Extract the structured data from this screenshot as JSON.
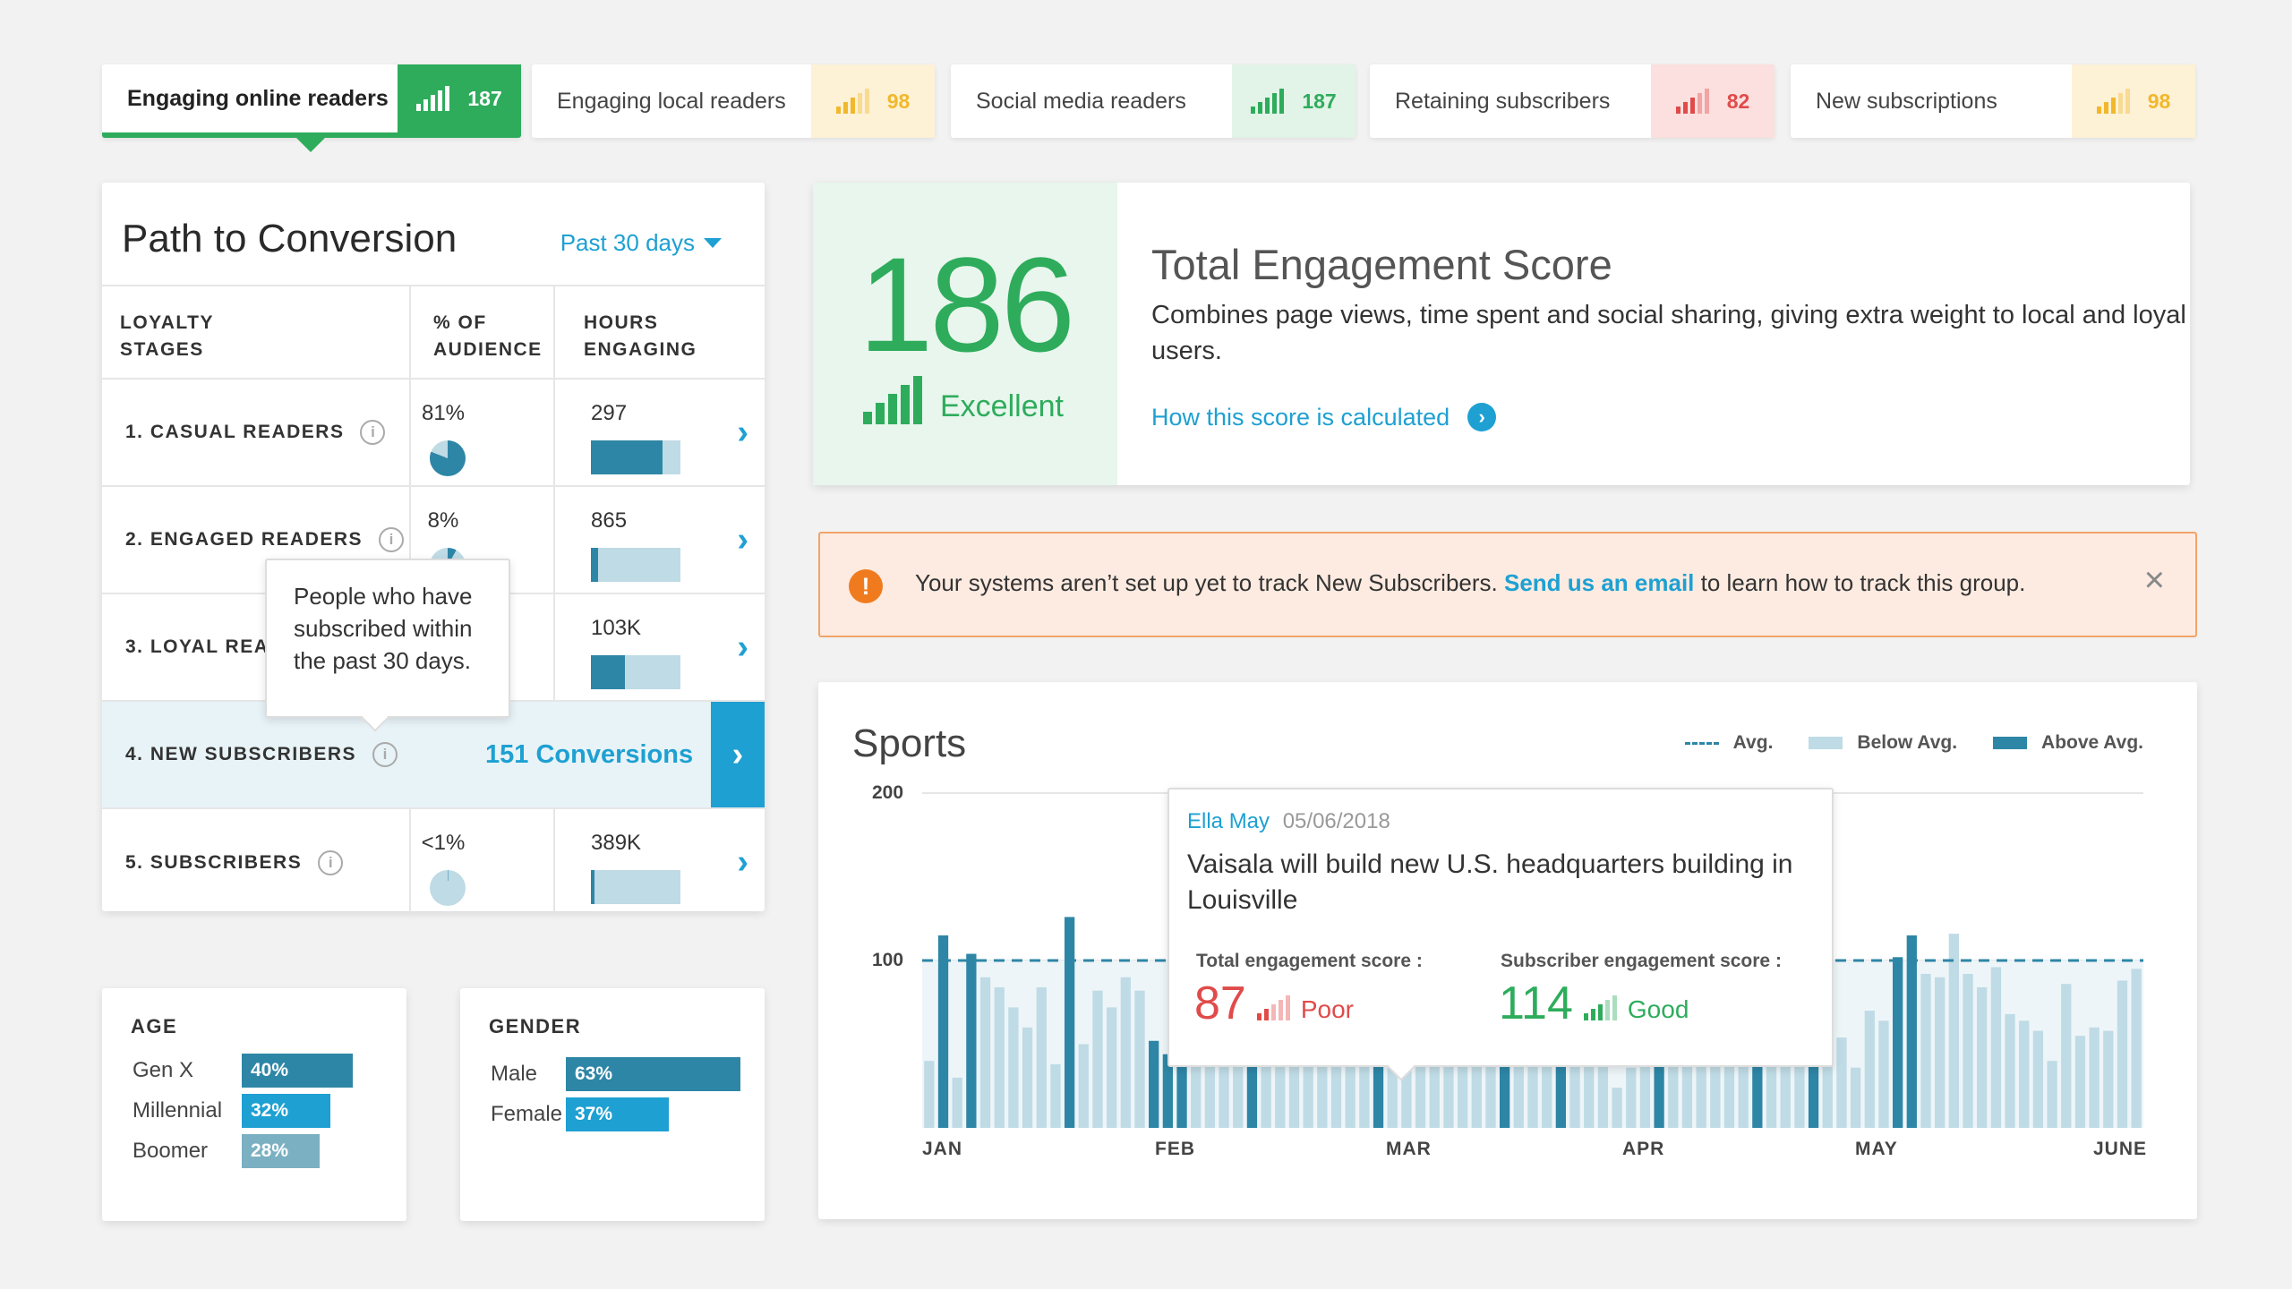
{
  "tabs": [
    {
      "label": "Engaging online readers",
      "score": "187",
      "tone": "active"
    },
    {
      "label": "Engaging local readers",
      "score": "98",
      "tone": "yellow"
    },
    {
      "label": "Social media readers",
      "score": "187",
      "tone": "green"
    },
    {
      "label": "Retaining subscribers",
      "score": "82",
      "tone": "red"
    },
    {
      "label": "New subscriptions",
      "score": "98",
      "tone": "yellow"
    }
  ],
  "ptc": {
    "title": "Path to Conversion",
    "period": "Past 30 days",
    "headers": {
      "stages": "LOYALTY\nSTAGES",
      "audience": "% OF\nAUDIENCE",
      "hours": "HOURS\nENGAGING"
    },
    "rows": [
      {
        "stage": "1. CASUAL READERS",
        "pct": "81%",
        "pct_value": 0.81,
        "hours": "297",
        "hours_fill": 0.8
      },
      {
        "stage": "2. ENGAGED READERS",
        "pct": "8%",
        "pct_value": 0.08,
        "hours": "865",
        "hours_fill": 0.08
      },
      {
        "stage": "3. LOYAL READERS",
        "pct": "",
        "pct_value": 0,
        "hours": "103K",
        "hours_fill": 0.38
      },
      {
        "stage": "4. NEW SUBSCRIBERS",
        "conversions": "151 Conversions"
      },
      {
        "stage": "5. SUBSCRIBERS",
        "pct": "<1%",
        "pct_value": 0.005,
        "hours": "389K",
        "hours_fill": 0.04
      }
    ],
    "tooltip": "People who have subscribed within the past 30 days."
  },
  "age": {
    "title": "AGE",
    "items": [
      {
        "label": "Gen X",
        "value": "40%",
        "fill": 0.4,
        "color": "#2e86a6"
      },
      {
        "label": "Millennial",
        "value": "32%",
        "fill": 0.32,
        "color": "#1ea0d2"
      },
      {
        "label": "Boomer",
        "value": "28%",
        "fill": 0.28,
        "color": "#7bb0c2"
      }
    ]
  },
  "gender": {
    "title": "GENDER",
    "items": [
      {
        "label": "Male",
        "value": "63%",
        "fill": 0.63,
        "color": "#2e86a6"
      },
      {
        "label": "Female",
        "value": "37%",
        "fill": 0.37,
        "color": "#1ea0d2"
      }
    ]
  },
  "score": {
    "value": "186",
    "rating": "Excellent",
    "title": "Total Engagement Score",
    "description": "Combines page views, time spent and social sharing, giving extra weight to local and loyal users.",
    "link": "How this score is calculated"
  },
  "alert": {
    "icon": "!",
    "text_before": "Your systems aren’t set up yet to track New Subscribers.",
    "link": "Send us an email",
    "text_after": "to learn how to track this group."
  },
  "sports": {
    "title": "Sports",
    "legend": {
      "avg": "Avg.",
      "below": "Below Avg.",
      "above": "Above Avg."
    },
    "tooltip": {
      "author": "Ella May",
      "date": "05/06/2018",
      "headline": "Vaisala will build new U.S. headquarters building in Louisville",
      "total_label": "Total engagement score :",
      "total_value": "87",
      "total_rating": "Poor",
      "sub_label": "Subscriber engagement score :",
      "sub_value": "114",
      "sub_rating": "Good"
    }
  },
  "colors": {
    "green": "#2eac5c",
    "blue": "#1ea0d2",
    "dark_bar": "#2e86a6",
    "light_bar": "#bfdbe5",
    "red": "#e04b4a",
    "yellow": "#f1b82c"
  },
  "chart_data": {
    "type": "bar",
    "title": "Sports",
    "x_ticks": [
      "JAN",
      "FEB",
      "MAR",
      "APR",
      "MAY",
      "JUNE"
    ],
    "y_ticks": [
      100,
      200
    ],
    "ylim": [
      0,
      215
    ],
    "average": 100,
    "values": [
      40,
      115,
      30,
      104,
      90,
      84,
      72,
      60,
      84,
      38,
      126,
      50,
      82,
      72,
      90,
      82,
      52,
      44,
      62,
      90,
      96,
      84,
      70,
      60,
      68,
      100,
      64,
      60,
      42,
      56,
      90,
      100,
      42,
      40,
      50,
      58,
      52,
      60,
      42,
      46,
      62,
      50,
      100,
      42,
      54,
      60,
      46,
      52,
      52,
      24,
      36,
      48,
      68,
      94,
      40,
      52,
      40,
      76,
      58,
      86,
      100,
      68,
      64,
      116,
      100,
      54,
      36,
      70,
      64,
      102,
      115,
      92,
      90,
      116,
      92,
      84,
      96,
      68,
      64,
      58,
      40,
      86,
      55,
      60,
      58,
      88,
      95
    ],
    "above_average_indices": [
      1,
      3,
      10,
      16,
      17,
      18,
      23,
      32,
      41,
      45,
      52,
      59,
      63,
      69,
      70
    ],
    "legend": [
      "Avg.",
      "Below Avg.",
      "Above Avg."
    ]
  }
}
